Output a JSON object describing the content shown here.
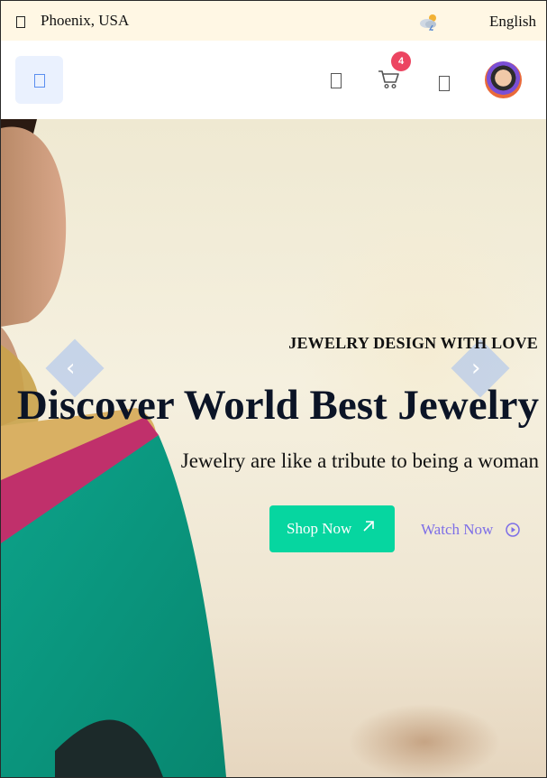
{
  "topbar": {
    "location_icon": "location-pin-icon",
    "location": "Phoenix, USA",
    "weather_icon": "cloud-sun-icon",
    "language": "English"
  },
  "header": {
    "menu_icon": "menu-icon",
    "search_icon": "search-icon",
    "cart_icon": "cart-icon",
    "cart_count": "4",
    "wishlist_icon": "heart-icon",
    "avatar": "user-avatar"
  },
  "hero": {
    "eyebrow": "JEWELRY DESIGN WITH LOVE",
    "title": "Discover World Best Jewelry",
    "subtitle": "Jewelry are like a tribute to being a woman",
    "primary_cta": "Shop Now",
    "primary_cta_icon": "arrow-up-right-icon",
    "secondary_cta": "Watch Now",
    "secondary_cta_icon": "play-circle-icon",
    "prev_icon": "chevron-left-icon",
    "next_icon": "chevron-right-icon",
    "prev_glyph": "‹",
    "next_glyph": "›"
  },
  "colors": {
    "topbar_bg": "#fff7e4",
    "accent_green": "#06d6a0",
    "accent_purple": "#7d6ee7",
    "badge_red": "#ec4561",
    "title_navy": "#0b1426"
  }
}
